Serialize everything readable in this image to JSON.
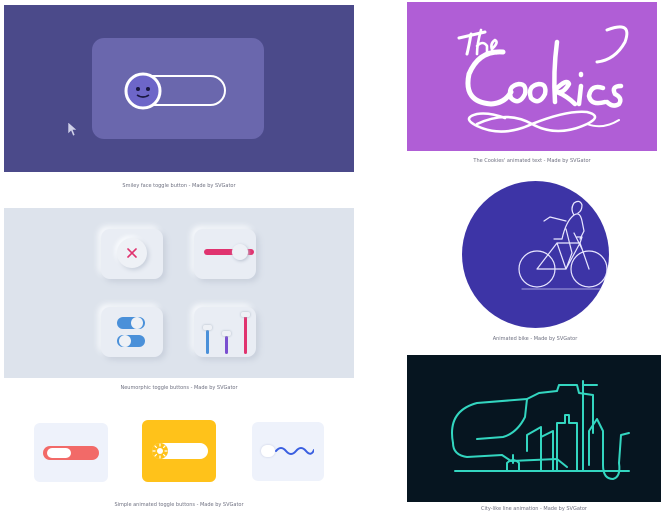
{
  "panels": [
    {
      "id": "smiley",
      "caption": "Smiley face toggle button - Made by SVGator",
      "colors": {
        "bg": "#4b4a8a",
        "card": "#6a67ad"
      }
    },
    {
      "id": "cookies",
      "caption": "The Cookies' animated text - Made by SVGator",
      "lettering": "The Cookies",
      "colors": {
        "bg": "#b05ed6"
      }
    },
    {
      "id": "neumorphic",
      "caption": "Neumorphic toggle buttons - Made by SVGator",
      "colors": {
        "bg": "#dde3ec",
        "accent": "#e0336f"
      }
    },
    {
      "id": "animated-bike",
      "caption": "Animated bike - Made by SVGator",
      "colors": {
        "bg": "#3d34a6"
      }
    },
    {
      "id": "simple-toggles",
      "caption": "Simple animated toggle buttons - Made by SVGator",
      "colors": {
        "red": "#f26a68",
        "yellow": "#ffc21a",
        "blue": "#3a5fe0"
      }
    },
    {
      "id": "city-line",
      "caption": "City-like line animation - Made by SVGator",
      "colors": {
        "bg": "#061520",
        "line": "#33d6c0"
      }
    }
  ],
  "icons": [
    "cursor-icon",
    "smiley-icon",
    "close-icon",
    "bicycle-icon",
    "sun-icon",
    "wave-icon"
  ]
}
